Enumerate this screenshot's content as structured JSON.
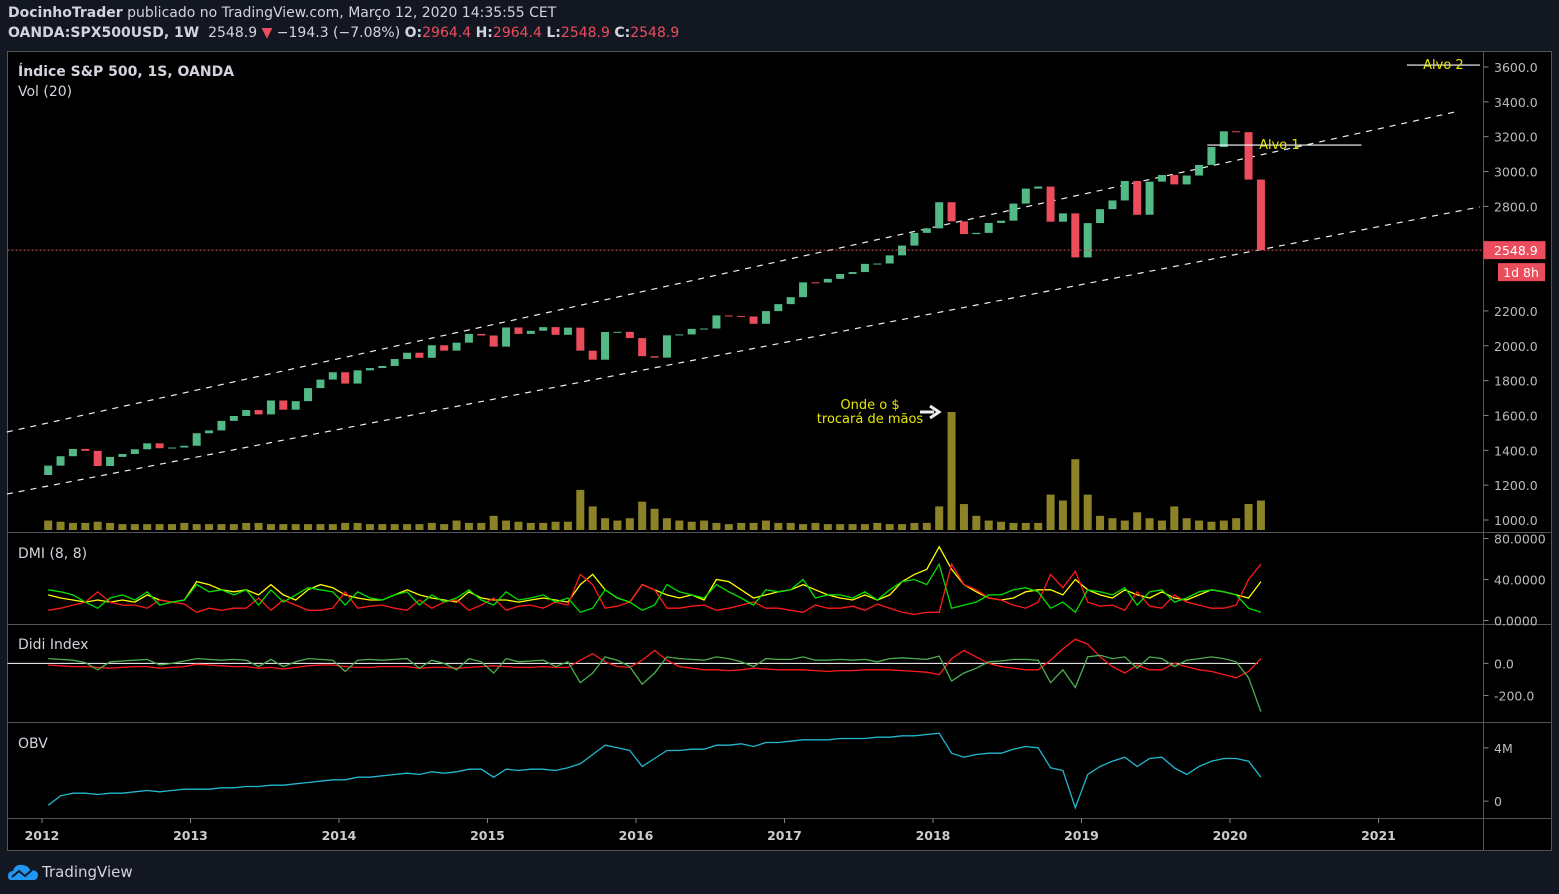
{
  "header": {
    "author": "DocinhoTrader",
    "published": "publicado no TradingView.com, Março 12, 2020 14:35:55 CET",
    "symbol": "OANDA:SPX500USD, 1W",
    "last": "2548.9",
    "change": "−194.3 (−7.08%)",
    "o_label": "O:",
    "o": "2964.4",
    "h_label": "H:",
    "h": "2964.4",
    "l_label": "L:",
    "l": "2548.9",
    "c_label": "C:",
    "c": "2548.9"
  },
  "footer": {
    "brand": "TradingView",
    "icon": "tradingview-cloud-icon"
  },
  "colors": {
    "up": "#53b987",
    "down": "#eb4d5c",
    "volume": "#8c8228",
    "plus_di": "#00e000",
    "minus_di": "#ff1a1a",
    "adx": "#ffff00",
    "didi_short": "#4caf50",
    "didi_long": "#ff1a1a",
    "obv": "#22b8cf",
    "annotation": "#e6e600",
    "background": "#000000"
  },
  "chart_data": {
    "type": "candlestick",
    "title": "Índice S&P 500, 1S, OANDA",
    "volume_label": "Vol (20)",
    "period_start": "2012-01",
    "period_step": "month",
    "first_open": 1258,
    "close": [
      1312,
      1366,
      1408,
      1397,
      1310,
      1362,
      1379,
      1406,
      1440,
      1412,
      1416,
      1426,
      1498,
      1514,
      1569,
      1597,
      1631,
      1606,
      1686,
      1633,
      1682,
      1757,
      1806,
      1848,
      1783,
      1859,
      1872,
      1884,
      1924,
      1960,
      1931,
      2003,
      1972,
      2018,
      2068,
      2059,
      1995,
      2105,
      2068,
      2086,
      2107,
      2063,
      2104,
      1972,
      1920,
      2079,
      2080,
      2044,
      1940,
      1932,
      2060,
      2065,
      2097,
      2099,
      2174,
      2171,
      2168,
      2126,
      2199,
      2239,
      2279,
      2364,
      2363,
      2384,
      2412,
      2423,
      2470,
      2472,
      2519,
      2575,
      2648,
      2674,
      2824,
      2714,
      2641,
      2648,
      2705,
      2718,
      2816,
      2902,
      2914,
      2712,
      2760,
      2507,
      2704,
      2784,
      2834,
      2946,
      2752,
      2942,
      2980,
      2926,
      2977,
      3038,
      3141,
      3231,
      3226,
      2954,
      2549
    ],
    "volume_relative": [
      8,
      7,
      6,
      6,
      7,
      6,
      5,
      5,
      5,
      5,
      5,
      6,
      5,
      5,
      5,
      5,
      6,
      6,
      5,
      5,
      5,
      5,
      5,
      5,
      6,
      6,
      5,
      5,
      5,
      5,
      5,
      6,
      5,
      8,
      6,
      6,
      12,
      8,
      7,
      6,
      6,
      7,
      7,
      34,
      20,
      10,
      8,
      10,
      24,
      18,
      10,
      8,
      7,
      8,
      6,
      5,
      6,
      6,
      8,
      6,
      6,
      5,
      6,
      5,
      5,
      5,
      5,
      6,
      5,
      5,
      6,
      6,
      20,
      100,
      22,
      12,
      8,
      7,
      6,
      6,
      6,
      30,
      25,
      60,
      30,
      12,
      10,
      8,
      15,
      10,
      8,
      20,
      10,
      8,
      7,
      8,
      10,
      22,
      25
    ],
    "price_ticks": [
      "3600.0",
      "3400.0",
      "3200.0",
      "3000.0",
      "2800.0",
      "2200.0",
      "2000.0",
      "1800.0",
      "1600.0",
      "1400.0",
      "1200.0",
      "1000.0"
    ],
    "price_tick_values": [
      3600,
      3400,
      3200,
      3000,
      2800,
      2200,
      2000,
      1800,
      1600,
      1400,
      1200,
      1000
    ],
    "ylim": [
      1000,
      3600
    ],
    "x_ticks": [
      "2012",
      "2013",
      "2014",
      "2015",
      "2016",
      "2017",
      "2018",
      "2019",
      "2020",
      "2021"
    ],
    "last_price_label": "2548.9",
    "last_price": 2548.9,
    "countdown_label": "1d 8h",
    "trendlines": [
      {
        "from": [
          "2011-10-06",
          1505
        ],
        "to": [
          "2021-07-07",
          3342
        ],
        "style": "dashed"
      },
      {
        "from": [
          "2011-10-06",
          1149
        ],
        "to": [
          "2021-09-07",
          2797
        ],
        "style": "dashed"
      }
    ],
    "targets": [
      {
        "label": "Alvo 1",
        "price": 3152,
        "from": "2019-11-06",
        "to": "2020-11-20"
      },
      {
        "label": "Alvo 2",
        "price": 3611,
        "from": "2021-03-10",
        "to": "2021-09-07"
      }
    ],
    "annotation": {
      "line1": "Onde o $",
      "line2": "trocará de mãos",
      "date": "2018-02"
    },
    "indicators": {
      "dmi": {
        "label": "DMI (8, 8)",
        "ticks": [
          "80.0000",
          "40.0000",
          "0.0000"
        ],
        "tick_values": [
          80,
          40,
          0
        ],
        "ylim": [
          0,
          82
        ],
        "plus_di": [
          30,
          28,
          25,
          18,
          12,
          22,
          25,
          20,
          28,
          15,
          18,
          20,
          35,
          28,
          30,
          25,
          30,
          15,
          30,
          18,
          25,
          32,
          30,
          28,
          15,
          28,
          22,
          20,
          25,
          28,
          15,
          25,
          18,
          22,
          30,
          20,
          15,
          28,
          20,
          22,
          25,
          18,
          22,
          8,
          12,
          30,
          22,
          18,
          10,
          15,
          35,
          28,
          25,
          22,
          35,
          28,
          22,
          15,
          30,
          28,
          30,
          40,
          22,
          25,
          25,
          22,
          28,
          20,
          30,
          38,
          40,
          35,
          55,
          12,
          15,
          18,
          25,
          25,
          30,
          32,
          28,
          12,
          18,
          8,
          30,
          28,
          25,
          32,
          15,
          28,
          30,
          18,
          22,
          28,
          30,
          28,
          25,
          12,
          8
        ],
        "minus_di": [
          10,
          12,
          15,
          18,
          28,
          18,
          15,
          15,
          12,
          20,
          18,
          16,
          8,
          12,
          10,
          12,
          12,
          22,
          10,
          20,
          15,
          10,
          10,
          12,
          28,
          12,
          14,
          15,
          12,
          10,
          20,
          12,
          18,
          20,
          10,
          15,
          22,
          10,
          14,
          15,
          12,
          18,
          15,
          45,
          35,
          12,
          14,
          18,
          35,
          30,
          12,
          12,
          14,
          15,
          10,
          12,
          15,
          18,
          12,
          12,
          10,
          8,
          15,
          12,
          12,
          14,
          10,
          16,
          12,
          8,
          6,
          8,
          8,
          55,
          35,
          30,
          22,
          20,
          15,
          12,
          18,
          45,
          32,
          48,
          18,
          14,
          15,
          10,
          28,
          14,
          12,
          25,
          18,
          15,
          12,
          12,
          15,
          40,
          55
        ],
        "adx": [
          25,
          22,
          20,
          18,
          20,
          18,
          20,
          18,
          25,
          20,
          18,
          20,
          38,
          35,
          30,
          28,
          30,
          25,
          35,
          25,
          20,
          30,
          35,
          32,
          25,
          22,
          20,
          20,
          25,
          30,
          25,
          22,
          20,
          18,
          28,
          22,
          20,
          20,
          18,
          20,
          22,
          20,
          18,
          35,
          45,
          30,
          22,
          18,
          35,
          30,
          25,
          22,
          25,
          20,
          40,
          38,
          30,
          22,
          25,
          28,
          30,
          35,
          30,
          25,
          22,
          20,
          25,
          20,
          25,
          38,
          45,
          50,
          72,
          50,
          35,
          28,
          22,
          20,
          22,
          28,
          30,
          30,
          25,
          40,
          30,
          25,
          22,
          30,
          25,
          22,
          28,
          22,
          20,
          25,
          30,
          28,
          25,
          22,
          38
        ]
      },
      "didi": {
        "label": "Didi Index",
        "ticks": [
          "0.0",
          "-200.0"
        ],
        "tick_values": [
          0,
          -200
        ],
        "ylim": [
          -343,
          217
        ],
        "short": [
          30,
          25,
          20,
          5,
          -40,
          10,
          15,
          20,
          25,
          -10,
          0,
          15,
          30,
          25,
          20,
          25,
          20,
          -20,
          25,
          -20,
          10,
          30,
          25,
          20,
          -50,
          20,
          25,
          20,
          25,
          30,
          -30,
          20,
          0,
          -40,
          30,
          10,
          -60,
          30,
          10,
          15,
          20,
          -20,
          10,
          -120,
          -60,
          40,
          20,
          -20,
          -130,
          -60,
          40,
          30,
          25,
          20,
          40,
          30,
          10,
          -20,
          30,
          25,
          25,
          40,
          20,
          20,
          25,
          20,
          25,
          10,
          30,
          35,
          30,
          25,
          45,
          -110,
          -60,
          -30,
          10,
          15,
          25,
          25,
          20,
          -120,
          -40,
          -150,
          40,
          50,
          30,
          40,
          -30,
          40,
          30,
          -20,
          20,
          30,
          40,
          30,
          10,
          -90,
          -300
        ],
        "long": [
          -10,
          -15,
          -20,
          -20,
          -25,
          -30,
          -25,
          -20,
          -20,
          -30,
          -25,
          -20,
          -5,
          -10,
          -15,
          -20,
          -20,
          -30,
          -25,
          -35,
          -25,
          -15,
          -10,
          -10,
          -20,
          -25,
          -25,
          -20,
          -20,
          -20,
          -30,
          -25,
          -25,
          -30,
          -25,
          -20,
          -15,
          -20,
          -25,
          -25,
          -20,
          -25,
          -25,
          20,
          60,
          10,
          -20,
          -25,
          20,
          80,
          20,
          -20,
          -30,
          -40,
          -40,
          -45,
          -40,
          -30,
          -35,
          -40,
          -40,
          -40,
          -45,
          -50,
          -45,
          -45,
          -40,
          -40,
          -40,
          -45,
          -50,
          -55,
          -70,
          30,
          80,
          40,
          0,
          -20,
          -30,
          -40,
          -40,
          20,
          90,
          150,
          120,
          40,
          -20,
          -60,
          -10,
          -40,
          -40,
          0,
          -20,
          -40,
          -50,
          -70,
          -90,
          -50,
          30
        ]
      },
      "obv": {
        "label": "OBV",
        "ticks": [
          "4M",
          "0"
        ],
        "tick_values": [
          4,
          0
        ],
        "unit": "millions",
        "ylim": [
          -1.0,
          5.6
        ],
        "values": [
          -0.3,
          0.4,
          0.6,
          0.6,
          0.5,
          0.6,
          0.6,
          0.7,
          0.8,
          0.7,
          0.8,
          0.9,
          0.9,
          0.9,
          1.0,
          1.0,
          1.1,
          1.1,
          1.2,
          1.2,
          1.3,
          1.4,
          1.5,
          1.6,
          1.6,
          1.8,
          1.8,
          1.9,
          2.0,
          2.1,
          2.0,
          2.2,
          2.1,
          2.2,
          2.4,
          2.4,
          1.8,
          2.4,
          2.3,
          2.4,
          2.4,
          2.3,
          2.5,
          2.8,
          3.5,
          4.2,
          4.0,
          3.8,
          2.6,
          3.2,
          3.8,
          3.8,
          3.9,
          3.9,
          4.2,
          4.2,
          4.3,
          4.1,
          4.4,
          4.4,
          4.5,
          4.6,
          4.6,
          4.6,
          4.7,
          4.7,
          4.7,
          4.8,
          4.8,
          4.9,
          4.9,
          5.0,
          5.1,
          3.6,
          3.3,
          3.5,
          3.6,
          3.6,
          3.9,
          4.1,
          4.0,
          2.5,
          2.3,
          -0.5,
          2.0,
          2.6,
          3.0,
          3.3,
          2.6,
          3.2,
          3.3,
          2.5,
          2.0,
          2.6,
          3.0,
          3.2,
          3.2,
          3.0,
          1.8
        ]
      }
    }
  }
}
